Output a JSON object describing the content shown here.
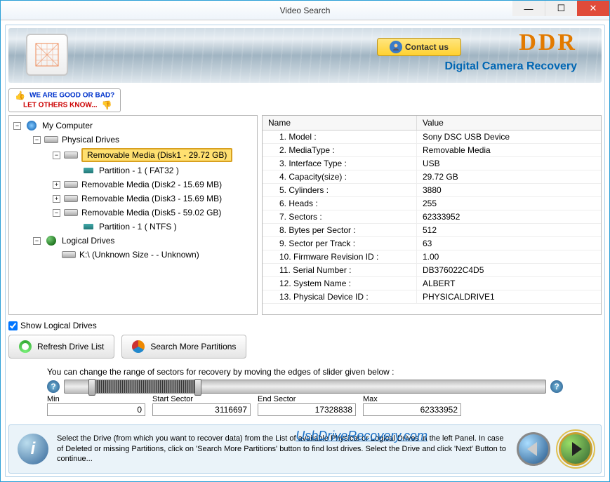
{
  "window": {
    "title": "Video Search"
  },
  "branding": {
    "ddr": "DDR",
    "product": "Digital Camera Recovery",
    "contact": "Contact us"
  },
  "feedback": {
    "line1": "WE ARE GOOD OR BAD?",
    "line2": "LET OTHERS KNOW..."
  },
  "tree": {
    "root": "My Computer",
    "physical": "Physical Drives",
    "rm1": "Removable Media (Disk1 - 29.72 GB)",
    "part1": "Partition - 1 ( FAT32 )",
    "rm2": "Removable Media (Disk2 - 15.69 MB)",
    "rm3": "Removable Media (Disk3 - 15.69 MB)",
    "rm5": "Removable Media (Disk5 - 59.02 GB)",
    "part5": "Partition - 1 ( NTFS )",
    "logical": "Logical Drives",
    "kdrive": "K:\\ (Unknown Size  -  - Unknown)"
  },
  "props": {
    "head_name": "Name",
    "head_value": "Value",
    "rows": [
      {
        "n": "1. Model :",
        "v": "Sony DSC USB Device"
      },
      {
        "n": "2. MediaType :",
        "v": "Removable Media"
      },
      {
        "n": "3. Interface Type :",
        "v": "USB"
      },
      {
        "n": "4. Capacity(size) :",
        "v": "29.72 GB"
      },
      {
        "n": "5. Cylinders :",
        "v": "3880"
      },
      {
        "n": "6. Heads :",
        "v": "255"
      },
      {
        "n": "7. Sectors :",
        "v": "62333952"
      },
      {
        "n": "8. Bytes per Sector :",
        "v": "512"
      },
      {
        "n": "9. Sector per Track :",
        "v": "63"
      },
      {
        "n": "10. Firmware Revision ID :",
        "v": "1.00"
      },
      {
        "n": "11. Serial Number :",
        "v": "DB376022C4D5"
      },
      {
        "n": "12. System Name :",
        "v": "ALBERT"
      },
      {
        "n": "13. Physical Device ID :",
        "v": "PHYSICALDRIVE1"
      }
    ]
  },
  "controls": {
    "show_logical": "Show Logical Drives",
    "refresh": "Refresh Drive List",
    "search_more": "Search More Partitions"
  },
  "slider": {
    "label": "You can change the range of sectors for recovery by moving the edges of slider given below :",
    "min_label": "Min",
    "min_value": "0",
    "start_label": "Start Sector",
    "start_value": "3116697",
    "end_label": "End Sector",
    "end_value": "17328838",
    "max_label": "Max",
    "max_value": "62333952"
  },
  "hint": "Select the Drive (from which you want to recover data) from the List of available Physical or Logical Drives in the left Panel. In case of Deleted or missing Partitions, click on 'Search More Partitions' button to find lost drives. Select the Drive and click 'Next' Button to continue...",
  "footer_link": "UsbDriveRecovery.com"
}
